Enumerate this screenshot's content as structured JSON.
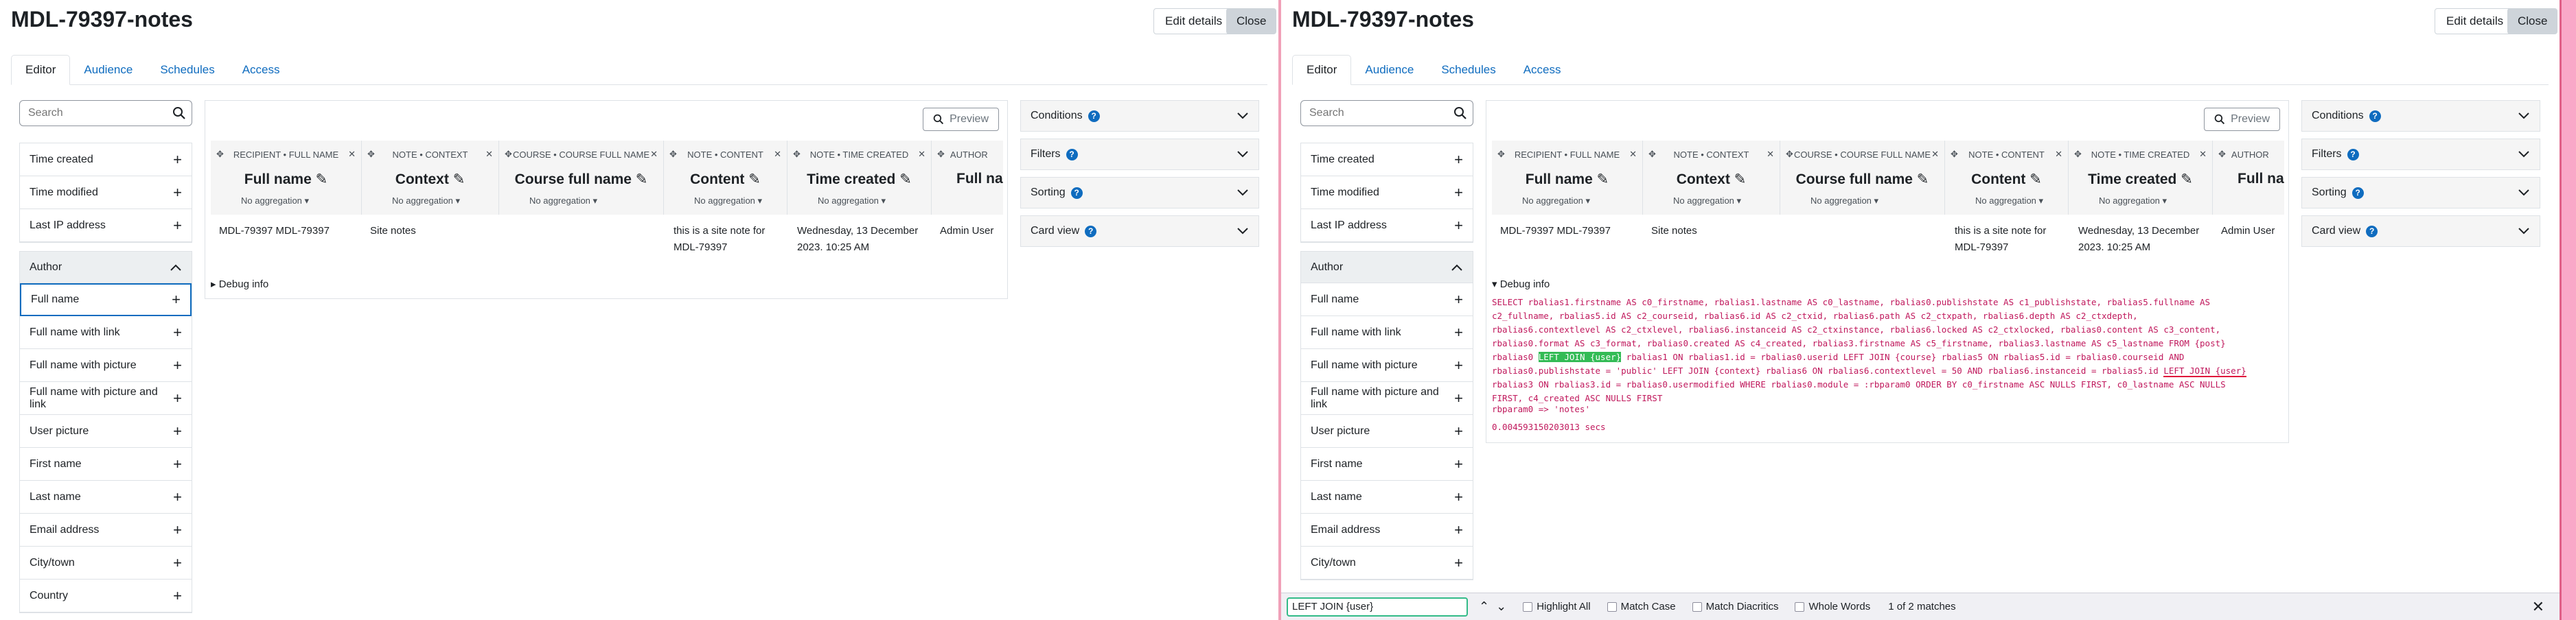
{
  "page": {
    "title": "MDL-79397-notes",
    "edit_details": "Edit details",
    "close": "Close"
  },
  "tabs": [
    "Editor",
    "Audience",
    "Schedules",
    "Access"
  ],
  "sidebar": {
    "search_placeholder": "Search",
    "top_fields": [
      "Time created",
      "Time modified",
      "Last IP address"
    ],
    "group_title": "Author",
    "left_fields": [
      "Full name",
      "Full name with link",
      "Full name with picture",
      "Full name with picture and link",
      "User picture",
      "First name",
      "Last name",
      "Email address",
      "City/town",
      "Country"
    ],
    "right_fields": [
      "Full name",
      "Full name with link",
      "Full name with picture",
      "Full name with picture and link",
      "User picture",
      "First name",
      "Last name",
      "Email address",
      "City/town"
    ]
  },
  "report": {
    "preview": "Preview",
    "columns": [
      {
        "source": "RECIPIENT • FULL NAME",
        "title": "Full name",
        "agg": "No aggregation"
      },
      {
        "source": "NOTE • CONTEXT",
        "title": "Context",
        "agg": "No aggregation"
      },
      {
        "source": "COURSE • COURSE FULL NAME",
        "title": "Course full name",
        "agg": "No aggregation"
      },
      {
        "source": "NOTE • CONTENT",
        "title": "Content",
        "agg": "No aggregation"
      },
      {
        "source": "NOTE • TIME CREATED",
        "title": "Time created",
        "agg": "No aggregation"
      },
      {
        "source": "AUTHOR",
        "title": "Full na",
        "agg": ""
      }
    ],
    "row": {
      "full_name": "MDL-79397 MDL-79397",
      "context": "Site notes",
      "content_l1": "this is a site note for",
      "content_l2": "MDL-79397",
      "time_l1": "Wednesday, 13 December",
      "time_l2": "2023, 10:25 AM",
      "author": "Admin User"
    },
    "debug_label": "Debug info"
  },
  "panels": [
    "Conditions",
    "Filters",
    "Sorting",
    "Card view"
  ],
  "debug": {
    "l1": "SELECT rbalias1.firstname AS c0_firstname, rbalias1.lastname AS c0_lastname, rbalias0.publishstate AS c1_publishstate, rbalias5.fullname AS",
    "l2": "c2_fullname, rbalias5.id AS c2_courseid, rbalias6.id AS c2_ctxid, rbalias6.path AS c2_ctxpath, rbalias6.depth AS c2_ctxdepth,",
    "l3": "rbalias6.contextlevel AS c2_ctxlevel, rbalias6.instanceid AS c2_ctxinstance, rbalias6.locked AS c2_ctxlocked, rbalias0.content AS c3_content,",
    "l4": "rbalias0.format AS c3_format, rbalias0.created AS c4_created, rbalias3.firstname AS c5_firstname, rbalias3.lastname AS c5_lastname FROM {post}",
    "l5a": "rbalias0 ",
    "l5hl": "LEFT JOIN {user}",
    "l5b": " rbalias1 ON rbalias1.id = rbalias0.userid LEFT JOIN {course} rbalias5 ON rbalias5.id = rbalias0.courseid AND",
    "l6a": "rbalias0.publishstate = 'public' LEFT JOIN {context} rbalias6 ON rbalias6.contextlevel = 50 AND rbalias6.instanceid = rbalias5.id ",
    "l6hl": "LEFT JOIN {user}",
    "l7": "rbalias3 ON rbalias3.id = rbalias0.usermodified WHERE rbalias0.module = :rbparam0 ORDER BY c0_firstname ASC NULLS FIRST, c0_lastname ASC NULLS",
    "l8": "FIRST, c4_created ASC NULLS FIRST",
    "param": "rbparam0 => 'notes'",
    "time": "0.004593150203013 secs"
  },
  "findbar": {
    "query": "LEFT JOIN {user}",
    "highlight_all": "Highlight All",
    "match_case": "Match Case",
    "match_diacritics": "Match Diacritics",
    "whole_words": "Whole Words",
    "count": "1 of 2 matches"
  },
  "colors": {
    "accent": "#0f6cbf",
    "sql": "#c0185c",
    "match": "#33bb55"
  }
}
